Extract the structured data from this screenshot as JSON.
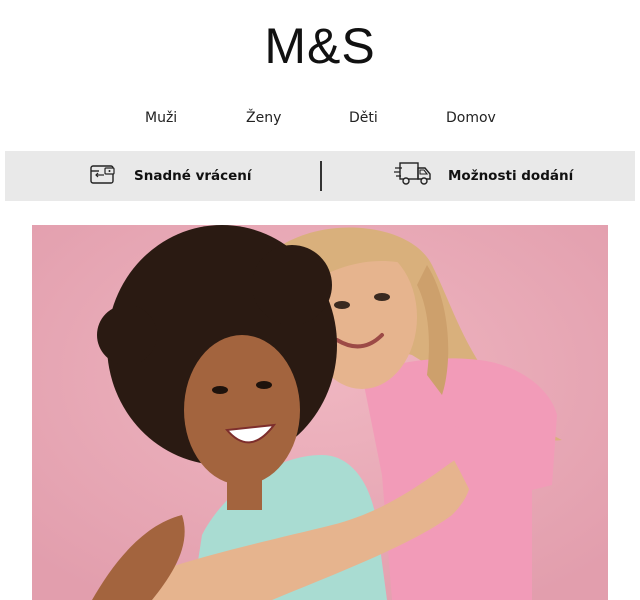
{
  "brand": {
    "logo_text": "M&S"
  },
  "nav": {
    "items": [
      {
        "label": "Muži"
      },
      {
        "label": "Ženy"
      },
      {
        "label": "Děti"
      },
      {
        "label": "Domov"
      }
    ]
  },
  "service_bar": {
    "returns": {
      "label": "Snadné vrácení",
      "icon": "return-box-icon"
    },
    "delivery": {
      "label": "Možnosti dodání",
      "icon": "delivery-truck-icon"
    }
  },
  "hero": {
    "image": "two-women-hugging-photo",
    "colors": {
      "background": "#e8a9b5",
      "pink_tshirt": "#f29bb8",
      "mint_tshirt": "#a9dcd2"
    }
  }
}
